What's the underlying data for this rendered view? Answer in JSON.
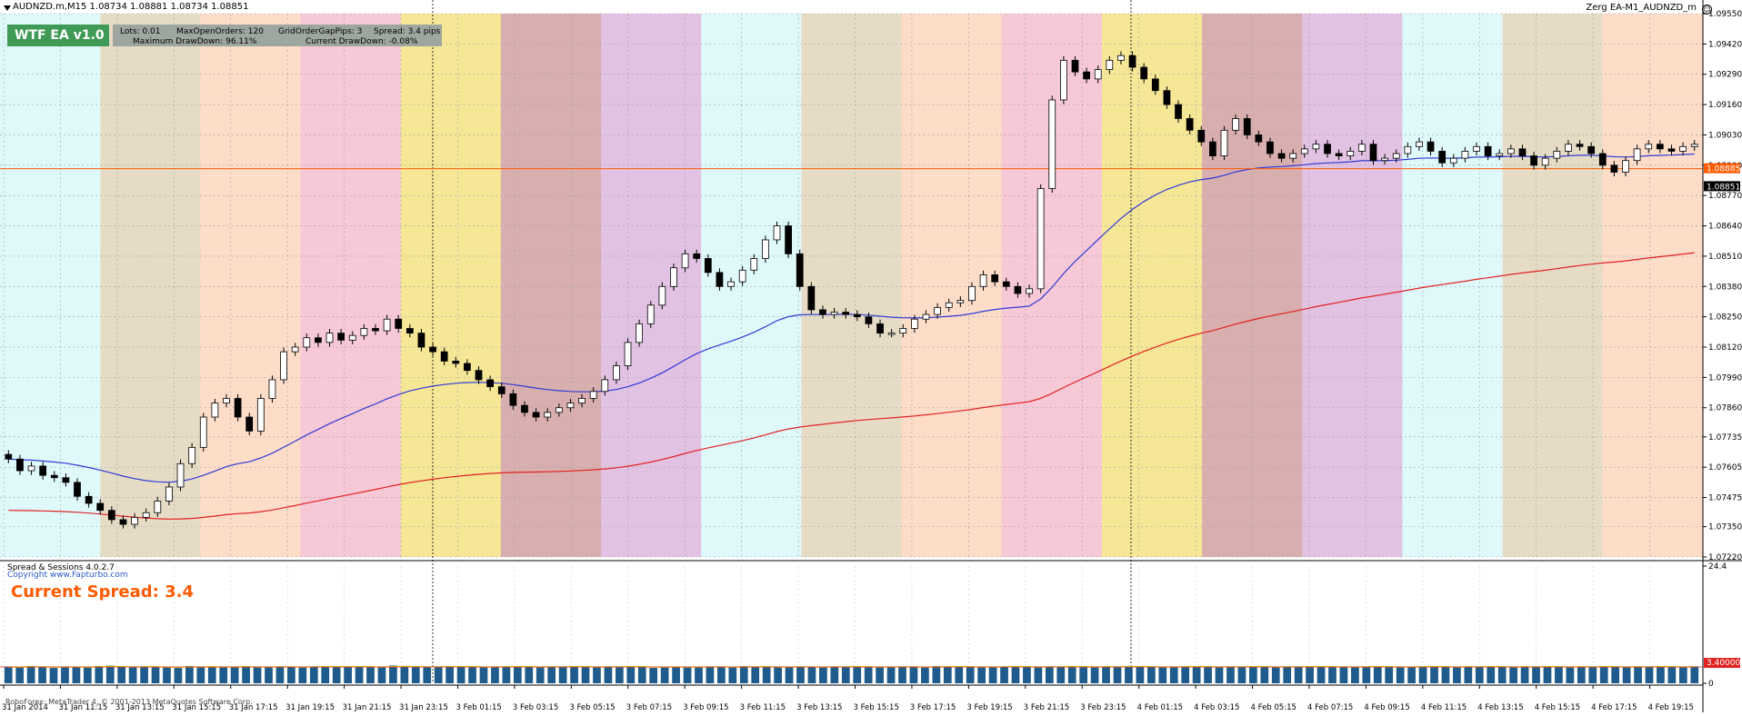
{
  "window": {
    "symbol_line": "AUDNZD.m,M15  1.08734 1.08881 1.08734 1.08851",
    "ea_label": "Zerg EA-M1_AUDNZD_m",
    "smile_glyph": "☺"
  },
  "ea_panel": {
    "badge": "WTF EA v1.0",
    "lots": "Lots: 0.01",
    "max_orders": "MaxOpenOrders: 120",
    "grid_gap": "GridOrderGapPips: 3",
    "spread": "Spread: 3.4 pips",
    "max_drawdown": "Maximum DrawDown: 96.11%",
    "current_drawdown": "Current DrawDown: -0.08%"
  },
  "indicator": {
    "title": "Spread & Sessions 4.0.2.7",
    "copyright": "Copyright www.Fapturbo.com",
    "current_spread_text": "Current Spread: 3.4",
    "footer": "RoboForex: MetaTrader 4, © 2001-2013 MetaQuotes Software Corp."
  },
  "colors": {
    "bull_candle": "#ffffff",
    "bear_candle": "#000000",
    "ma_fast": "#2f3bd6",
    "ma_slow": "#e02222",
    "hline": "#ff5a00",
    "spread_bar": "#1f5b8c",
    "spread_avg": "#e8e800",
    "spread_current": "#e02222",
    "price_tag_bg": "#ff5a00",
    "price_tag_current_bg": "#000000"
  },
  "sessions": [
    {
      "color": "#dff9fb"
    },
    {
      "color": "#e6dcc5"
    },
    {
      "color": "#fddcc8"
    },
    {
      "color": "#f7c8d6"
    },
    {
      "color": "#f6e796"
    },
    {
      "color": "#d9aeae"
    },
    {
      "color": "#e2c2e3"
    },
    {
      "color": "#dff9fb"
    },
    {
      "color": "#e6dcc5"
    },
    {
      "color": "#fddcc8"
    },
    {
      "color": "#f7c8d6"
    },
    {
      "color": "#f6e796"
    },
    {
      "color": "#d9aeae"
    },
    {
      "color": "#e2c2e3"
    },
    {
      "color": "#dff9fb"
    },
    {
      "color": "#e6dcc5"
    },
    {
      "color": "#fddcc8"
    }
  ],
  "chart_data": {
    "type": "candlestick",
    "price_ticks": [
      "1.09550",
      "1.09420",
      "1.09290",
      "1.09160",
      "1.09030",
      "1.08900",
      "1.08770",
      "1.08640",
      "1.08510",
      "1.08380",
      "1.08250",
      "1.08120",
      "1.07990",
      "1.07860",
      "1.07735",
      "1.07605",
      "1.07475",
      "1.07350",
      "1.07220"
    ],
    "price_range": [
      1.0722,
      1.0955
    ],
    "bid_tag": "1.08851",
    "ask_tag": "1.08885",
    "time_ticks": [
      "31 Jan 2014",
      "31 Jan 11:15",
      "31 Jan 13:15",
      "31 Jan 15:15",
      "31 Jan 17:15",
      "31 Jan 19:15",
      "31 Jan 21:15",
      "31 Jan 23:15",
      "3 Feb 01:15",
      "3 Feb 03:15",
      "3 Feb 05:15",
      "3 Feb 07:15",
      "3 Feb 09:15",
      "3 Feb 11:15",
      "3 Feb 13:15",
      "3 Feb 15:15",
      "3 Feb 17:15",
      "3 Feb 19:15",
      "3 Feb 21:15",
      "3 Feb 23:15",
      "4 Feb 01:15",
      "4 Feb 03:15",
      "4 Feb 05:15",
      "4 Feb 07:15",
      "4 Feb 09:15",
      "4 Feb 11:15",
      "4 Feb 13:15",
      "4 Feb 15:15",
      "4 Feb 17:15",
      "4 Feb 19:15"
    ],
    "closes": [
      1.0764,
      1.0759,
      1.0761,
      1.0757,
      1.0756,
      1.0754,
      1.0748,
      1.0745,
      1.0742,
      1.0738,
      1.0736,
      1.0739,
      1.0741,
      1.0746,
      1.0752,
      1.0762,
      1.0769,
      1.0782,
      1.0788,
      1.079,
      1.0782,
      1.0776,
      1.079,
      1.0798,
      1.081,
      1.0812,
      1.0816,
      1.0814,
      1.0818,
      1.0815,
      1.0817,
      1.082,
      1.0819,
      1.0824,
      1.082,
      1.0818,
      1.0812,
      1.081,
      1.0806,
      1.0805,
      1.0802,
      1.0798,
      1.0795,
      1.0792,
      1.0787,
      1.0784,
      1.0782,
      1.0784,
      1.0786,
      1.0788,
      1.079,
      1.0793,
      1.0798,
      1.0804,
      1.0814,
      1.0822,
      1.083,
      1.0838,
      1.0846,
      1.0852,
      1.085,
      1.0844,
      1.0838,
      1.084,
      1.0845,
      1.085,
      1.0858,
      1.0864,
      1.0852,
      1.0838,
      1.0828,
      1.0826,
      1.0827,
      1.0826,
      1.0825,
      1.0822,
      1.0818,
      1.0818,
      1.082,
      1.0824,
      1.0826,
      1.0829,
      1.0831,
      1.0832,
      1.0838,
      1.0843,
      1.084,
      1.0838,
      1.0835,
      1.0837,
      1.088,
      1.0918,
      1.0935,
      1.093,
      1.0927,
      1.0931,
      1.0935,
      1.0937,
      1.0932,
      1.0927,
      1.0922,
      1.0916,
      1.091,
      1.0905,
      1.09,
      1.0894,
      1.0905,
      1.091,
      1.0903,
      1.09,
      1.0895,
      1.0893,
      1.0895,
      1.0897,
      1.0899,
      1.0895,
      1.0894,
      1.0896,
      1.0899,
      1.0892,
      1.0893,
      1.0895,
      1.0898,
      1.09,
      1.0896,
      1.0891,
      1.0893,
      1.0896,
      1.0898,
      1.0894,
      1.0895,
      1.0897,
      1.0894,
      1.089,
      1.0893,
      1.0896,
      1.0899,
      1.0898,
      1.0895,
      1.089,
      1.0887,
      1.0892,
      1.0897,
      1.0899,
      1.0897,
      1.0896,
      1.0898,
      1.0899
    ],
    "spread_ticks": [
      "24.4",
      "0"
    ],
    "spread_current_tag": "3.40000",
    "spread_values": [
      3.4,
      3.3,
      3.6,
      3.4,
      3.2,
      3.5,
      3.4,
      3.3,
      3.6,
      3.7,
      3.4,
      3.3,
      3.5,
      3.4,
      3.3,
      3.2,
      3.6,
      3.4,
      3.5,
      3.3,
      3.4,
      3.6,
      3.3,
      3.4,
      3.5,
      3.4,
      3.3,
      3.5,
      3.6,
      3.4,
      3.4,
      3.5,
      3.4,
      3.3,
      3.7,
      3.6,
      3.4,
      3.3,
      3.4,
      3.6,
      3.5,
      3.4,
      3.3,
      3.4,
      3.5,
      3.6,
      3.4,
      3.3,
      3.5,
      3.4,
      3.6,
      3.4,
      3.3,
      3.5,
      3.4,
      3.6,
      3.4,
      3.2,
      3.4,
      3.5,
      3.3,
      3.4,
      3.5,
      3.4,
      3.3,
      3.6,
      3.4,
      3.5,
      3.3,
      3.4,
      3.5,
      3.4,
      3.3,
      3.5,
      3.4,
      3.6,
      3.4,
      3.3,
      3.4,
      3.5,
      3.4,
      3.3,
      3.6,
      3.4,
      3.5,
      3.4,
      3.3,
      3.4,
      3.5,
      3.6,
      3.4,
      3.3,
      3.5,
      3.4,
      3.6,
      3.4,
      3.3,
      3.5,
      3.4,
      3.6,
      3.5,
      3.4,
      3.3,
      3.4,
      3.5,
      3.6,
      3.4,
      3.3,
      3.5,
      3.4,
      3.6,
      3.4,
      3.3,
      3.5,
      3.4,
      3.6,
      3.4,
      3.5,
      3.3,
      3.4,
      3.5,
      3.6,
      3.4,
      3.3,
      3.4,
      3.5,
      3.6,
      3.4,
      3.3,
      3.5,
      3.4,
      3.6,
      3.4,
      3.3,
      3.5,
      3.4,
      3.6,
      3.4,
      3.3,
      3.5,
      3.4,
      3.6,
      3.4,
      3.3,
      3.5,
      3.4,
      3.6,
      3.4,
      3.3,
      3.5
    ]
  }
}
